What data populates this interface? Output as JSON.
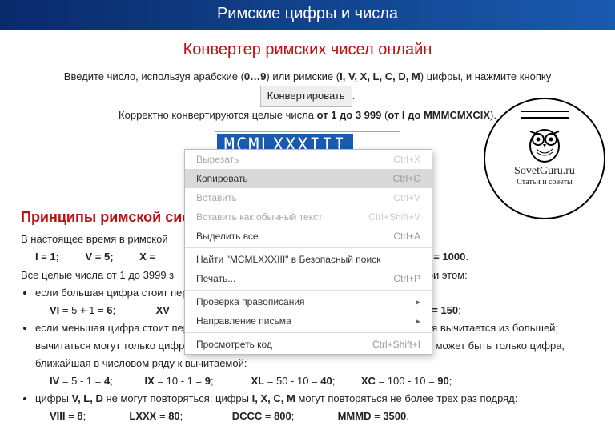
{
  "header": {
    "title": "Римские цифры и числа"
  },
  "converter": {
    "title": "Конвертер римских чисел онлайн",
    "intro_prefix": "Введите число, используя арабские (",
    "arabic_range": "0…9",
    "intro_mid1": ") или римские (",
    "roman_letters": "I, V, X, L, C, D, M",
    "intro_mid2": ") цифры, и нажмите кнопку",
    "convert_btn": "Конвертировать",
    "intro_suffix": ".",
    "correct_prefix": "Корректно конвертируются целые числа ",
    "range_bold": "от 1 до 3 999",
    "correct_mid": " (",
    "range_roman_bold": "от I до MMMCMXCIX",
    "correct_suffix": ").",
    "input_value": "MCMLXXXIII",
    "selected_text": "MCMLXXXIII"
  },
  "logo": {
    "brand": "SovetGuru.ru",
    "sub": "Статьи и советы"
  },
  "context_menu": {
    "items": [
      {
        "label": "Вырезать",
        "shortcut": "Ctrl+X",
        "disabled": true
      },
      {
        "label": "Копировать",
        "shortcut": "Ctrl+C",
        "highlight": true
      },
      {
        "label": "Вставить",
        "shortcut": "Ctrl+V",
        "disabled": true
      },
      {
        "label": "Вставить как обычный текст",
        "shortcut": "Ctrl+Shift+V",
        "disabled": true
      },
      {
        "label": "Выделить все",
        "shortcut": "Ctrl+A"
      }
    ],
    "search": "Найти \"MCMLXXXIII\" в Безопасный поиск",
    "print": {
      "label": "Печать...",
      "shortcut": "Ctrl+P"
    },
    "spell": "Проверка правописания",
    "direction": "Направление письма",
    "inspect": {
      "label": "Просмотреть код",
      "shortcut": "Ctrl+Shift+I"
    }
  },
  "principles": {
    "title": "Принципы римской сист",
    "p1_prefix": "В настоящее время в римской",
    "d1": "I = 1;",
    "d2": "V = 5;",
    "d3": "X =",
    "d4": "= 1000",
    "p2_prefix": "Все целые числа от 1 до 3999 з",
    "p2_suffix": "При этом:",
    "li1": "если большая цифра стоит пер",
    "e1": "VI",
    "e1v": " = 5 + 1 = ",
    "e1r": "6",
    "e1sep": ";",
    "e2": "XV",
    "e2r": "= 150",
    "li2_a": "если меньшая цифра стоит пер",
    "li2_b": "), то меньшая вычитается из большей; вычитаться могут только цифры, обозначающие 1 или степени 10; уменьшаемым может быть только цифра, ближайшая в числовом ряду к вычитаемой:",
    "f1": "IV",
    "f1v": " = 5 - 1 = ",
    "f1r": "4",
    "sep": ";",
    "f2": "IX",
    "f2v": " = 10 - 1 = ",
    "f2r": "9",
    "f3": "XL",
    "f3v": " = 50 - 10 = ",
    "f3r": "40",
    "f4": "XC",
    "f4v": " = 100 - 10 = ",
    "f4r": "90",
    "li3_a": "цифры ",
    "li3_b": "V, L, D",
    "li3_c": " не могут повторяться; цифры ",
    "li3_d": "I, X, C, M",
    "li3_e": " могут повторяться не более трех раз подряд:",
    "g1": "VIII",
    "g1v": " = ",
    "g1r": "8",
    "g2": "LXXX",
    "g2v": " = ",
    "g2r": "80",
    "g3": "DCCC",
    "g3v": " = ",
    "g3r": "800",
    "g4": "MMMD",
    "g4v": " = ",
    "g4r": "3500"
  }
}
